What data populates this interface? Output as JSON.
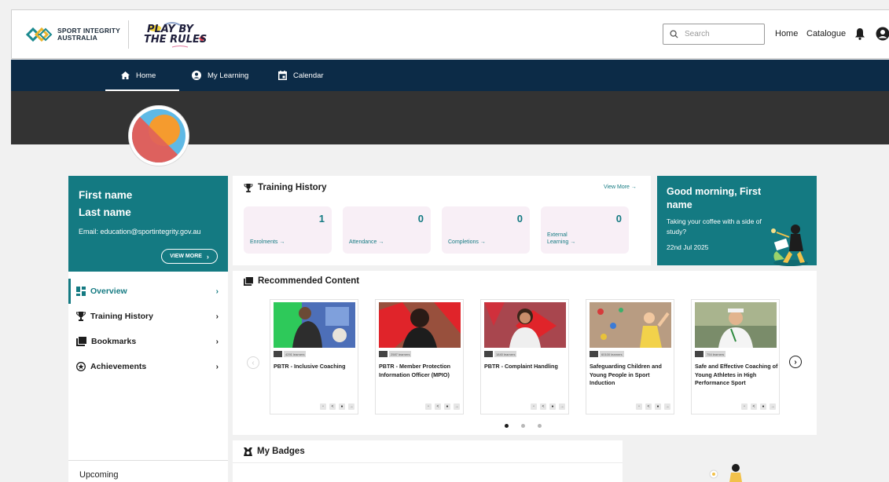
{
  "header": {
    "sia_logo_line1": "SPORT INTEGRITY",
    "sia_logo_line2": "AUSTRALIA",
    "pbtr_line1": "PLAY BY",
    "pbtr_line2": "THE RULES",
    "search_placeholder": "Search",
    "links": [
      "Home",
      "Catalogue"
    ]
  },
  "nav": {
    "items": [
      {
        "label": "Home",
        "active": true
      },
      {
        "label": "My Learning",
        "active": false
      },
      {
        "label": "Calendar",
        "active": false
      }
    ]
  },
  "profile": {
    "first_name": "First name",
    "last_name": "Last name",
    "email": "Email: education@sportintegrity.gov.au",
    "view_more": "VIEW MORE"
  },
  "sidemenu": {
    "items": [
      {
        "label": "Overview",
        "icon": "grid-icon",
        "active": true
      },
      {
        "label": "Training History",
        "icon": "trophy-icon",
        "active": false
      },
      {
        "label": "Bookmarks",
        "icon": "bookmark-icon",
        "active": false
      },
      {
        "label": "Achievements",
        "icon": "star-icon",
        "active": false
      }
    ],
    "upcoming": "Upcoming"
  },
  "training_history": {
    "title": "Training History",
    "view_more": "View More",
    "stats": [
      {
        "label": "Enrolments",
        "value": "1"
      },
      {
        "label": "Attendance",
        "value": "0"
      },
      {
        "label": "Completions",
        "value": "0"
      },
      {
        "label_line1": "External",
        "label_line2": "Learning",
        "value": "0"
      }
    ]
  },
  "greeting": {
    "headline": "Good morning, First name",
    "subtitle": "Taking your coffee with a side of study?",
    "date": "22nd Jul 2025"
  },
  "recommended": {
    "title": "Recommended Content",
    "cards": [
      {
        "title": "PBTR - Inclusive Coaching",
        "learners": "4291 learners"
      },
      {
        "title": "PBTR - Member Protection Information Officer (MPIO)",
        "learners": "2587 learners"
      },
      {
        "title": "PBTR - Complaint Handling",
        "learners": "1840 learners"
      },
      {
        "title": "Safeguarding Children and Young People in Sport Induction",
        "learners": "60100 learners"
      },
      {
        "title": "Safe and Effective Coaching of Young Athletes in High Performance Sport",
        "learners": "754 learners"
      }
    ]
  },
  "badges": {
    "title": "My Badges"
  },
  "colors": {
    "teal": "#147a82",
    "navy": "#0c2b47",
    "banner": "#333333",
    "stat_bg": "#f8eff6"
  }
}
